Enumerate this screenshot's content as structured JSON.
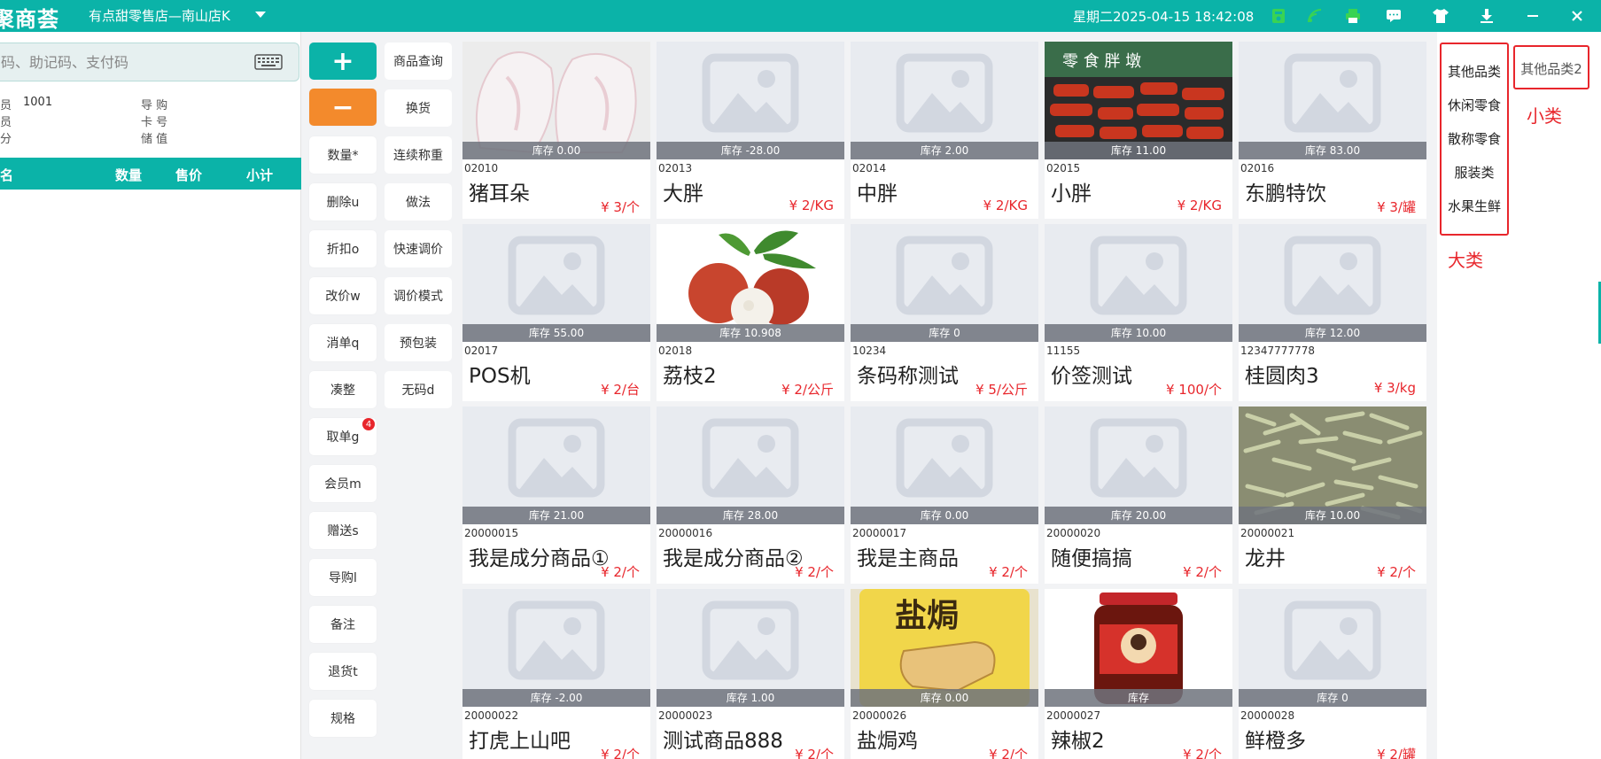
{
  "topbar": {
    "logo": "聚商荟",
    "store": "有点甜零售店—南山店K",
    "datetime": "星期二2025-04-15 18:42:08"
  },
  "search": {
    "placeholder": "码、助记码、支付码"
  },
  "info": {
    "member_label": "员",
    "member_value": "1001",
    "cashier_label": "员",
    "points_label": "分",
    "guide_label": "导 购",
    "card_label": "卡 号",
    "stored_label": "储 值"
  },
  "table": {
    "columns": [
      "名",
      "数量",
      "售价",
      "小计"
    ]
  },
  "actions_col1": [
    {
      "label": "数量*"
    },
    {
      "label": "删除u"
    },
    {
      "label": "折扣o"
    },
    {
      "label": "改价w"
    },
    {
      "label": "消单q"
    },
    {
      "label": "凑整"
    },
    {
      "label": "取单g",
      "badge": "4"
    },
    {
      "label": "会员m"
    },
    {
      "label": "赠送s"
    },
    {
      "label": "导购l"
    },
    {
      "label": "备注"
    },
    {
      "label": "退货t"
    },
    {
      "label": "规格"
    }
  ],
  "actions_col2": [
    {
      "label": "商品查询"
    },
    {
      "label": "换货"
    },
    {
      "label": "连续称重"
    },
    {
      "label": "做法"
    },
    {
      "label": "快速调价"
    },
    {
      "label": "调价模式"
    },
    {
      "label": "预包装"
    },
    {
      "label": "无码d"
    }
  ],
  "buttons": {
    "plus": "+",
    "minus": "−"
  },
  "products": [
    {
      "code": "02010",
      "name": "猪耳朵",
      "price": "¥ 3/个",
      "stock": "库存 0.00",
      "img": "pigear"
    },
    {
      "code": "02013",
      "name": "大胖",
      "price": "¥ 2/KG",
      "stock": "库存 -28.00",
      "img": "placeholder"
    },
    {
      "code": "02014",
      "name": "中胖",
      "price": "¥ 2/KG",
      "stock": "库存 2.00",
      "img": "placeholder"
    },
    {
      "code": "02015",
      "name": "小胖",
      "price": "¥ 2/KG",
      "stock": "库存 11.00",
      "img": "snack"
    },
    {
      "code": "02016",
      "name": "东鹏特饮",
      "price": "¥ 3/罐",
      "stock": "库存 83.00",
      "img": "placeholder"
    },
    {
      "code": "02017",
      "name": "POS机",
      "price": "¥ 2/台",
      "stock": "库存 55.00",
      "img": "placeholder"
    },
    {
      "code": "02018",
      "name": "荔枝2",
      "price": "¥ 2/公斤",
      "stock": "库存 10.908",
      "img": "lychee"
    },
    {
      "code": "10234",
      "name": "条码称测试",
      "price": "¥ 5/公斤",
      "stock": "库存 0",
      "img": "placeholder"
    },
    {
      "code": "11155",
      "name": "价签测试",
      "price": "¥ 100/个",
      "stock": "库存 10.00",
      "img": "placeholder"
    },
    {
      "code": "12347777778",
      "name": "桂圆肉3",
      "price": "¥ 3/kg",
      "stock": "库存 12.00",
      "img": "placeholder"
    },
    {
      "code": "20000015",
      "name": "我是成分商品①",
      "price": "¥ 2/个",
      "stock": "库存 21.00",
      "img": "placeholder"
    },
    {
      "code": "20000016",
      "name": "我是成分商品②",
      "price": "¥ 2/个",
      "stock": "库存 28.00",
      "img": "placeholder"
    },
    {
      "code": "20000017",
      "name": "我是主商品",
      "price": "¥ 2/个",
      "stock": "库存 0.00",
      "img": "placeholder"
    },
    {
      "code": "20000020",
      "name": "随便搞搞",
      "price": "¥ 2/个",
      "stock": "库存 20.00",
      "img": "placeholder"
    },
    {
      "code": "20000021",
      "name": "龙井",
      "price": "¥ 2/个",
      "stock": "库存 10.00",
      "img": "tea"
    },
    {
      "code": "20000022",
      "name": "打虎上山吧",
      "price": "¥ 2/个",
      "stock": "库存 -2.00",
      "img": "placeholder"
    },
    {
      "code": "20000023",
      "name": "测试商品888",
      "price": "¥ 2/个",
      "stock": "库存 1.00",
      "img": "placeholder"
    },
    {
      "code": "20000026",
      "name": "盐焗鸡",
      "price": "¥ 2/个",
      "stock": "库存 0.00",
      "img": "chicken"
    },
    {
      "code": "20000027",
      "name": "辣椒2",
      "price": "¥ 2/个",
      "stock": "库存",
      "img": "chili"
    },
    {
      "code": "20000028",
      "name": "鲜橙多",
      "price": "¥ 2/罐",
      "stock": "库存 0",
      "img": "placeholder"
    }
  ],
  "categories": {
    "big": [
      "其他品类",
      "休闲零食",
      "散称零食",
      "服装类",
      "水果生鲜"
    ],
    "small": [
      "其他品类2"
    ],
    "big_label": "大类",
    "small_label": "小类"
  },
  "colors": {
    "accent": "#0bb3a8",
    "minus": "#f38a2c",
    "price": "#e8262c"
  }
}
